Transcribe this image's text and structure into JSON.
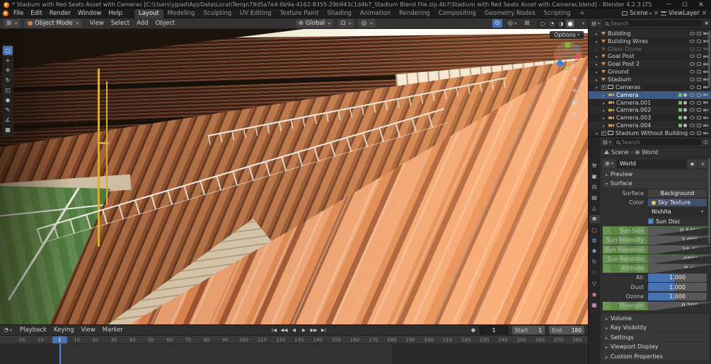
{
  "titlebar": {
    "title": "* Stadium with Red Seats Asset with Cameras [C:\\Users\\yjpad\\AppData\\Local\\Temp\\79d5a7e4-6b9a-4162-8355-29b943c1d4b7_Stadium Blend File.zip.4b7\\Stadium with Red Seats Asset with Cameras.blend] - Blender 4.2.3 LTS"
  },
  "topbar": {
    "menus": [
      {
        "label": "File"
      },
      {
        "label": "Edit"
      },
      {
        "label": "Render"
      },
      {
        "label": "Window"
      },
      {
        "label": "Help"
      }
    ],
    "workspaces": [
      {
        "label": "Layout",
        "active": true
      },
      {
        "label": "Modeling"
      },
      {
        "label": "Sculpting"
      },
      {
        "label": "UV Editing"
      },
      {
        "label": "Texture Paint"
      },
      {
        "label": "Shading"
      },
      {
        "label": "Animation"
      },
      {
        "label": "Rendering"
      },
      {
        "label": "Compositing"
      },
      {
        "label": "Geometry Nodes"
      },
      {
        "label": "Scripting"
      }
    ],
    "add_workspace": "+",
    "scene": {
      "label": "Scene"
    },
    "viewlayer": {
      "label": "ViewLayer"
    }
  },
  "viewport": {
    "header": {
      "mode": "Object Mode",
      "menus": [
        {
          "label": "View"
        },
        {
          "label": "Select"
        },
        {
          "label": "Add"
        },
        {
          "label": "Object"
        }
      ],
      "orientation": "Global",
      "shading": [
        {
          "name": "wireframe",
          "glyph": "○"
        },
        {
          "name": "solid",
          "glyph": "◔"
        },
        {
          "name": "material-preview",
          "glyph": "◑"
        },
        {
          "name": "rendered",
          "glyph": "●",
          "active": true
        }
      ]
    },
    "tool_settings": {
      "options_label": "Options"
    },
    "toolbar": [
      {
        "name": "tweak-select",
        "glyph": "▢",
        "active": true
      },
      {
        "name": "cursor",
        "glyph": "+"
      },
      {
        "name": "move",
        "glyph": "✛"
      },
      {
        "name": "rotate",
        "glyph": "↻"
      },
      {
        "name": "scale",
        "glyph": "◰"
      },
      {
        "name": "transform",
        "glyph": "◉"
      },
      {
        "name": "annotate",
        "glyph": "✎"
      },
      {
        "name": "measure",
        "glyph": "∠"
      },
      {
        "name": "add-cube",
        "glyph": "▦"
      }
    ],
    "nav": {
      "zoom_glyph": "⊕",
      "pan_glyph": "✛",
      "camera_glyph": "▣",
      "persp_glyph": "⊞"
    }
  },
  "outliner": {
    "search_placeholder": "Search",
    "items": [
      {
        "label": "Building",
        "type": "mesh"
      },
      {
        "label": "Building Wires",
        "type": "mesh"
      },
      {
        "label": "Glass Dome",
        "type": "mesh",
        "dimmed": true
      },
      {
        "label": "Goal Post",
        "type": "mesh"
      },
      {
        "label": "Goal Post 2",
        "type": "mesh"
      },
      {
        "label": "Ground",
        "type": "mesh"
      },
      {
        "label": "Stadium",
        "type": "mesh"
      },
      {
        "label": "Cameras",
        "type": "collection"
      },
      {
        "label": "Camera",
        "type": "camera",
        "sub": true,
        "selected": true
      },
      {
        "label": "Camera.001",
        "type": "camera",
        "sub": true
      },
      {
        "label": "Camera.002",
        "type": "camera",
        "sub": true
      },
      {
        "label": "Camera.003",
        "type": "camera",
        "sub": true
      },
      {
        "label": "Camera.004",
        "type": "camera",
        "sub": true
      },
      {
        "label": "Stadium Without Building",
        "type": "collection"
      }
    ]
  },
  "properties": {
    "search_placeholder": "Search",
    "breadcrumb": {
      "scene": "Scene",
      "world": "World"
    },
    "datablock": {
      "name": "World"
    },
    "sections": {
      "preview": {
        "label": "Preview"
      },
      "surface": {
        "label": "Surface"
      }
    },
    "tabs": [
      {
        "name": "tool",
        "glyph": "⚒",
        "color": "#bdbdbd"
      },
      {
        "name": "render",
        "glyph": "▣",
        "color": "#bdbdbd"
      },
      {
        "name": "output",
        "glyph": "⊟",
        "color": "#bdbdbd"
      },
      {
        "name": "view-layer",
        "glyph": "▤",
        "color": "#bdbdbd"
      },
      {
        "name": "scene",
        "glyph": "△",
        "color": "#bdbdbd"
      },
      {
        "name": "world",
        "glyph": "⊕",
        "color": "#f0f0f0",
        "active": true
      },
      {
        "name": "object",
        "glyph": "▢",
        "color": "#e8954e"
      },
      {
        "name": "modifiers",
        "glyph": "⚙",
        "color": "#85b4e8"
      },
      {
        "name": "particles",
        "glyph": "✱",
        "color": "#85b4e8"
      },
      {
        "name": "physics",
        "glyph": "↻",
        "color": "#85b4e8"
      },
      {
        "name": "constraints",
        "glyph": "∷",
        "color": "#bdbdbd"
      },
      {
        "name": "object-data",
        "glyph": "▽",
        "color": "#8fd48f"
      },
      {
        "name": "material",
        "glyph": "◉",
        "color": "#e88585"
      },
      {
        "name": "texture",
        "glyph": "▦",
        "color": "#e8a5c5"
      }
    ],
    "fields": [
      {
        "label": "Surface",
        "value": "Background",
        "kind": "button"
      },
      {
        "label": "Color",
        "value": "Sky Texture",
        "kind": "color"
      },
      {
        "label": "",
        "value": "Nishita",
        "kind": "dropdown"
      },
      {
        "label": "",
        "value": "Sun Disc",
        "kind": "check"
      },
      {
        "label": "Sun Size",
        "value": "0.545°",
        "kind": "field"
      },
      {
        "label": "Sun Intensity",
        "value": "1.000",
        "kind": "field"
      },
      {
        "label": "Sun Elevation",
        "value": "18.4°",
        "kind": "field"
      },
      {
        "label": "Sun Rotation",
        "value": "-989°",
        "kind": "field"
      },
      {
        "label": "Altitude",
        "value": "0 m",
        "kind": "field"
      },
      {
        "label": "Air",
        "value": "1.000",
        "kind": "slider",
        "fill": "45%"
      },
      {
        "label": "Dust",
        "value": "1.000",
        "kind": "slider",
        "fill": "45%"
      },
      {
        "label": "Ozone",
        "value": "1.000",
        "kind": "slider",
        "fill": "45%"
      },
      {
        "label": "Strength",
        "value": "0.200",
        "kind": "field"
      }
    ],
    "collapsed_sections": [
      {
        "label": "Volume"
      },
      {
        "label": "Ray Visibility"
      },
      {
        "label": "Settings"
      },
      {
        "label": "Viewport Display"
      },
      {
        "label": "Custom Properties"
      }
    ]
  },
  "timeline": {
    "menus": [
      {
        "label": "Playback"
      },
      {
        "label": "Keying"
      },
      {
        "label": "View"
      },
      {
        "label": "Marker"
      }
    ],
    "transport": [
      {
        "name": "jump-to-start",
        "glyph": "|◀"
      },
      {
        "name": "prev-keyframe",
        "glyph": "◀◀"
      },
      {
        "name": "play-reverse",
        "glyph": "◀"
      },
      {
        "name": "play",
        "glyph": "▶"
      },
      {
        "name": "next-keyframe",
        "glyph": "▶▶"
      },
      {
        "name": "jump-to-end",
        "glyph": "▶|"
      }
    ],
    "current_frame": "1",
    "start": {
      "label": "Start",
      "value": "1"
    },
    "end": {
      "label": "End",
      "value": "180"
    },
    "playhead": {
      "frame": "1"
    },
    "ticks": [
      "-20",
      "-10",
      "0",
      "10",
      "20",
      "30",
      "40",
      "50",
      "60",
      "70",
      "80",
      "90",
      "100",
      "110",
      "120",
      "130",
      "140",
      "150",
      "160",
      "170",
      "180",
      "190",
      "200",
      "210",
      "220",
      "230",
      "240",
      "250",
      "260",
      "270",
      "280"
    ]
  }
}
